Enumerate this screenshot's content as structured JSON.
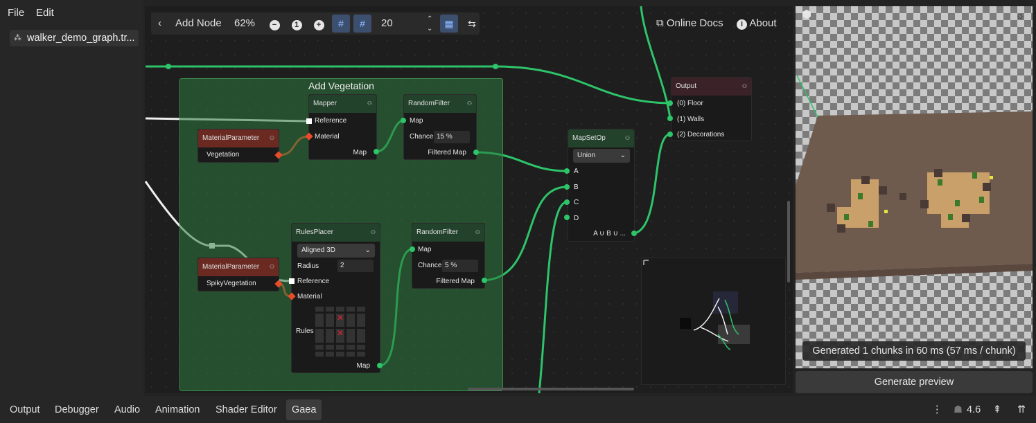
{
  "menu": {
    "file": "File",
    "edit": "Edit"
  },
  "scene_tab": {
    "label": "walker_demo_graph.tr..."
  },
  "toolbar": {
    "add_node": "Add Node",
    "zoom": "62%",
    "snap_value": "20",
    "online_docs": "Online Docs",
    "about": "About"
  },
  "frame": {
    "title": "Add Vegetation"
  },
  "nodes": {
    "mapper": {
      "title": "Mapper",
      "ports": [
        "Reference",
        "Material",
        "Map"
      ]
    },
    "random_filter_1": {
      "title": "RandomFilter",
      "ports": [
        "Map",
        "Chance",
        "Filtered Map"
      ],
      "chance": "15 %"
    },
    "material_param_1": {
      "title": "MaterialParameter",
      "value": "Vegetation"
    },
    "material_param_2": {
      "title": "MaterialParameter",
      "value": "SpikyVegetation"
    },
    "rules_placer": {
      "title": "RulesPlacer",
      "mode": "Aligned 3D",
      "radius_label": "Radius",
      "radius": "2",
      "ports": [
        "Reference",
        "Material",
        "Rules",
        "Map"
      ]
    },
    "random_filter_2": {
      "title": "RandomFilter",
      "ports": [
        "Map",
        "Chance",
        "Filtered Map"
      ],
      "chance": "5 %"
    },
    "mapsetop": {
      "title": "MapSetOp",
      "op": "Union",
      "ports": [
        "A",
        "B",
        "C",
        "D"
      ],
      "output": "A ∪ B ∪ ..."
    },
    "output": {
      "title": "Output",
      "ports": [
        "(0) Floor",
        "(1) Walls",
        "(2) Decorations"
      ]
    }
  },
  "preview": {
    "status": "Generated 1 chunks in 60 ms (57 ms / chunk)",
    "generate_button": "Generate preview"
  },
  "bottom_tabs": [
    "Output",
    "Debugger",
    "Audio",
    "Animation",
    "Shader Editor",
    "Gaea"
  ],
  "version": "4.6",
  "colors": {
    "accent_green": "#2ec46a",
    "material_red": "#e84a2a",
    "frame_green": "#2c783c"
  }
}
